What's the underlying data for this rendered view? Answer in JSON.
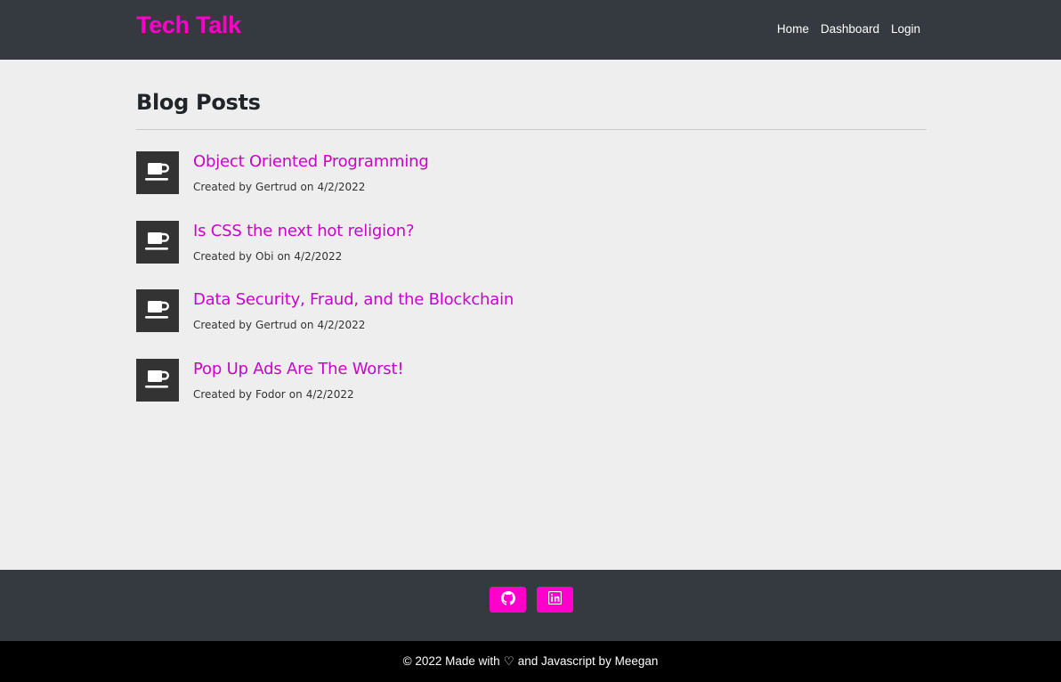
{
  "colors": {
    "accent": "#ff00cc",
    "link": "#cc00cc",
    "navbar_bg": "#343a40",
    "page_bg": "#eeeeee",
    "thumb_bg": "#333333",
    "footer_bottom_bg": "#000000"
  },
  "header": {
    "brand": "Tech Talk",
    "nav": [
      {
        "label": "Home"
      },
      {
        "label": "Dashboard"
      },
      {
        "label": "Login"
      }
    ]
  },
  "main": {
    "heading": "Blog Posts",
    "posts": [
      {
        "title": "Object Oriented Programming",
        "created_prefix": "Created by",
        "author": "Gertrud",
        "date_prefix": "on",
        "date": "4/2/2022",
        "icon": "coffee-cup-icon"
      },
      {
        "title": "Is CSS the next hot religion?",
        "created_prefix": "Created by",
        "author": "Obi",
        "date_prefix": "on",
        "date": "4/2/2022",
        "icon": "coffee-cup-icon"
      },
      {
        "title": "Data Security, Fraud, and the Blockchain",
        "created_prefix": "Created by",
        "author": "Gertrud",
        "date_prefix": "on",
        "date": "4/2/2022",
        "icon": "coffee-cup-icon"
      },
      {
        "title": "Pop Up Ads Are The Worst!",
        "created_prefix": "Created by",
        "author": "Fodor",
        "date_prefix": "on",
        "date": "4/2/2022",
        "icon": "coffee-cup-icon"
      }
    ]
  },
  "footer": {
    "social": [
      {
        "icon": "github-icon"
      },
      {
        "icon": "linkedin-icon"
      }
    ],
    "copyright_pre": "© 2022 Made with",
    "heart": "♡",
    "copyright_post": "and Javascript by Meegan"
  }
}
